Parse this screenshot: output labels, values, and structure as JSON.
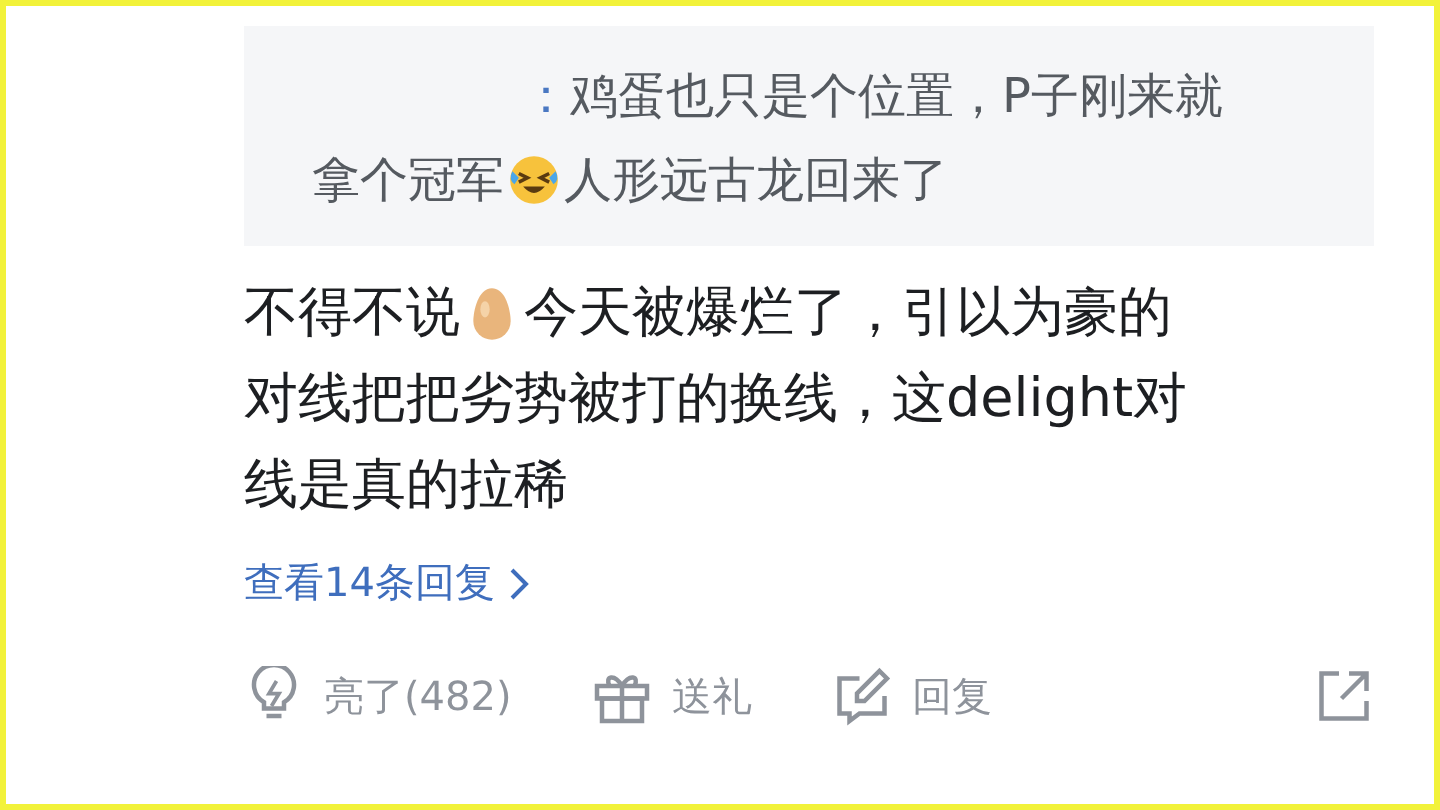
{
  "quote": {
    "separator": "：",
    "lines": [
      [
        {
          "kind": "text",
          "text": "鸡蛋也只是个位置，P子刚来就"
        }
      ],
      [
        {
          "kind": "text",
          "text": "拿个冠军"
        },
        {
          "kind": "laugh"
        },
        {
          "kind": "text",
          "text": "人形远古龙回来了"
        }
      ]
    ]
  },
  "comment": {
    "lines": [
      [
        {
          "kind": "text",
          "text": "不得不说"
        },
        {
          "kind": "egg"
        },
        {
          "kind": "text",
          "text": "今天被爆烂了，引以为豪的"
        }
      ],
      [
        {
          "kind": "text",
          "text": "对线把把劣势被打的换线，这delight对"
        }
      ],
      [
        {
          "kind": "text",
          "text": "线是真的拉稀"
        }
      ]
    ]
  },
  "replies_link": "查看14条回复",
  "actions": [
    {
      "kind": "like",
      "label": "亮了(482)"
    },
    {
      "kind": "gift",
      "label": "送礼"
    },
    {
      "kind": "reply",
      "label": "回复"
    },
    {
      "kind": "share"
    }
  ]
}
